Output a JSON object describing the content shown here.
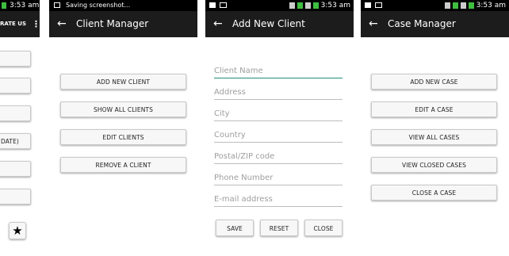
{
  "screen1": {
    "time": "3:53 am",
    "rate_label": "RATE US",
    "partial_text": "DATE)"
  },
  "screen2": {
    "status_text": "Saving screenshot...",
    "title": "Client Manager",
    "buttons": [
      "ADD NEW CLIENT",
      "SHOW ALL CLIENTS",
      "EDIT CLIENTS",
      "REMOVE A CLIENT"
    ]
  },
  "screen3": {
    "time": "3:53 am",
    "title": "Add New Client",
    "fields": [
      "Client Name",
      "Address",
      "City",
      "Country",
      "Postal/ZIP code",
      "Phone Number",
      "E-mail address"
    ],
    "actions": [
      "SAVE",
      "RESET",
      "CLOSE"
    ]
  },
  "screen4": {
    "time": "3:53 am",
    "title": "Case Manager",
    "buttons": [
      "ADD NEW CASE",
      "EDIT A CASE",
      "VIEW ALL CASES",
      "VIEW CLOSED CASES",
      "CLOSE A CASE"
    ]
  },
  "colors": {
    "appbar": "#1c1c1c",
    "statusbar": "#000000",
    "accent": "#1e8e7e"
  }
}
